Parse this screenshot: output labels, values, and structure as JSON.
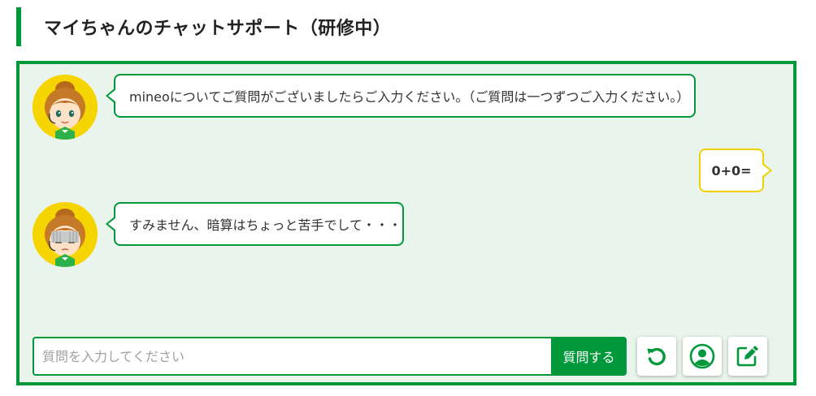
{
  "page": {
    "title": "マイちゃんのチャットサポート（研修中）"
  },
  "colors": {
    "brand_green": "#00983a",
    "chat_background": "#e8f4ec",
    "user_bubble_border": "#f0d000",
    "avatar_background": "#f6d400"
  },
  "messages": [
    {
      "sender": "bot",
      "avatar_icon": "mai-chan-avatar-smiling",
      "text": "mineoについてご質問がございましたらご入力ください。（ご質問は一つずつご入力ください。）"
    },
    {
      "sender": "user",
      "text": "0+0="
    },
    {
      "sender": "bot",
      "avatar_icon": "mai-chan-avatar-troubled",
      "text": "すみません、暗算はちょっと苦手でして・・・",
      "trailing_icon": "pen-scribble-icon"
    }
  ],
  "composer": {
    "placeholder": "質問を入力してください",
    "submit_label": "質問する",
    "tools": [
      {
        "icon": "refresh-icon"
      },
      {
        "icon": "user-icon"
      },
      {
        "icon": "edit-icon"
      }
    ]
  }
}
